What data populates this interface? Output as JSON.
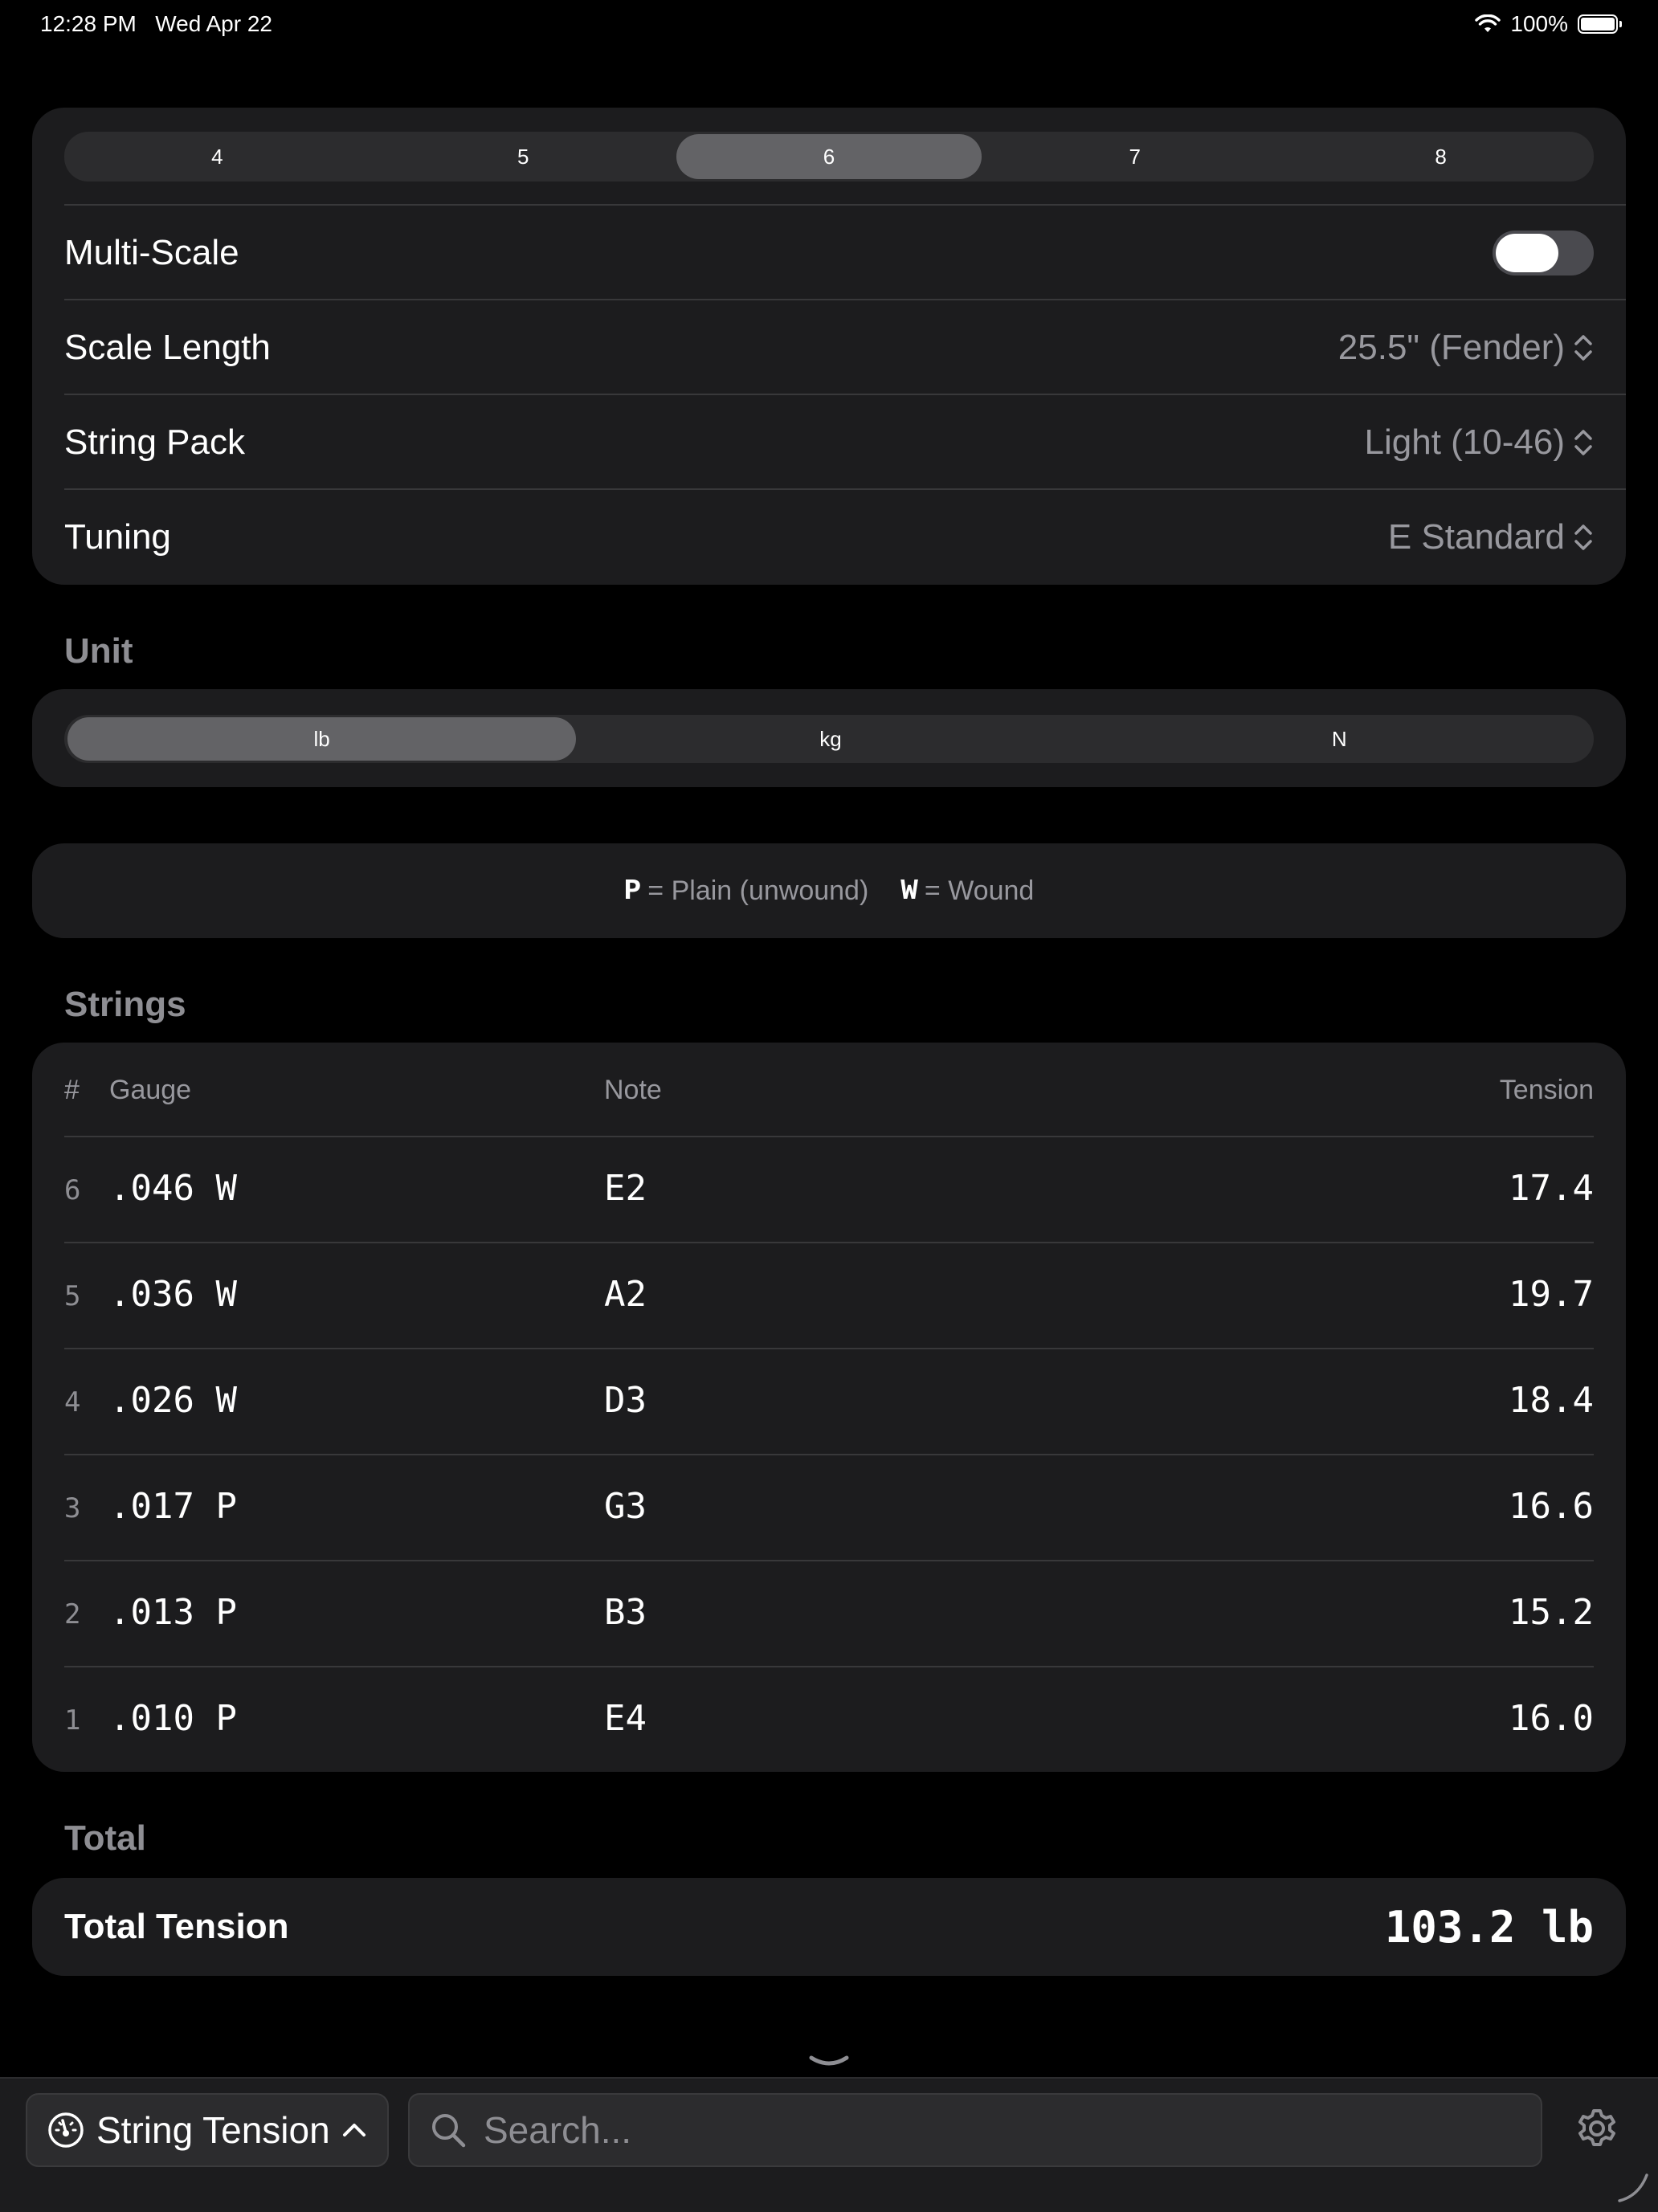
{
  "status": {
    "time": "12:28 PM",
    "date": "Wed Apr 22",
    "battery": "100%"
  },
  "string_count": {
    "options": [
      "4",
      "5",
      "6",
      "7",
      "8"
    ],
    "selected": "6"
  },
  "settings": {
    "multiscale_label": "Multi-Scale",
    "multiscale_on": false,
    "scale_label": "Scale Length",
    "scale_value": "25.5\" (Fender)",
    "pack_label": "String Pack",
    "pack_value": "Light (10-46)",
    "tuning_label": "Tuning",
    "tuning_value": "E Standard"
  },
  "unit": {
    "header": "Unit",
    "options": [
      "lb",
      "kg",
      "N"
    ],
    "selected": "lb"
  },
  "legend": {
    "plain_key": "P",
    "plain_text": "= Plain (unwound)",
    "wound_key": "W",
    "wound_text": "= Wound"
  },
  "strings": {
    "header": "Strings",
    "columns": {
      "num": "#",
      "gauge": "Gauge",
      "note": "Note",
      "tension": "Tension"
    },
    "rows": [
      {
        "num": "6",
        "gauge": ".046 W",
        "note": "E2",
        "tension": "17.4"
      },
      {
        "num": "5",
        "gauge": ".036 W",
        "note": "A2",
        "tension": "19.7"
      },
      {
        "num": "4",
        "gauge": ".026 W",
        "note": "D3",
        "tension": "18.4"
      },
      {
        "num": "3",
        "gauge": ".017 P",
        "note": "G3",
        "tension": "16.6"
      },
      {
        "num": "2",
        "gauge": ".013 P",
        "note": "B3",
        "tension": "15.2"
      },
      {
        "num": "1",
        "gauge": ".010 P",
        "note": "E4",
        "tension": "16.0"
      }
    ]
  },
  "total": {
    "header": "Total",
    "label": "Total Tension",
    "value": "103.2 lb"
  },
  "toolbar": {
    "tool_label": "String Tension",
    "search_placeholder": "Search..."
  }
}
